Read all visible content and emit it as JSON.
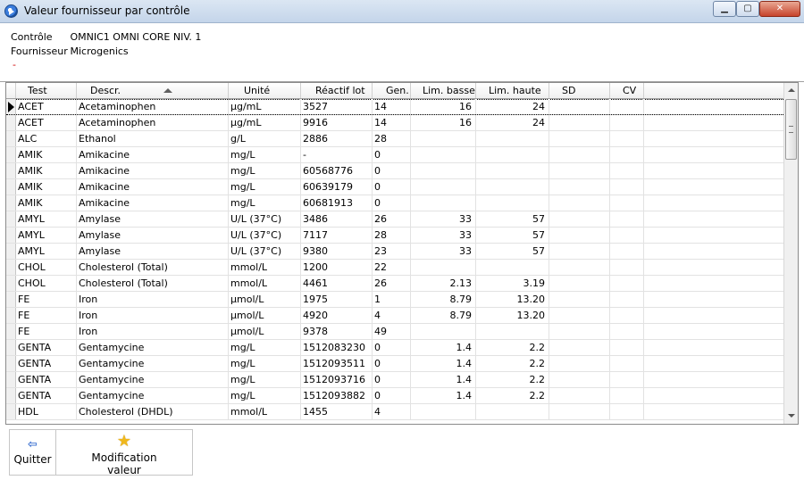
{
  "window": {
    "title": "Valeur fournisseur par contrôle",
    "minimize": "▁",
    "maximize": "▢",
    "close": "✕"
  },
  "info": {
    "control_label": "Contrôle",
    "control_value": "OMNIC1 OMNI CORE NIV. 1",
    "supplier_label": "Fournisseur",
    "supplier_value": "Microgenics",
    "dash": "-"
  },
  "grid": {
    "columns": [
      "Test",
      "Descr.",
      "Unité",
      "Réactif lot",
      "Gen.",
      "Lim. basse",
      "Lim. haute",
      "SD",
      "CV"
    ],
    "rows": [
      [
        "ACET",
        "Acetaminophen",
        "µg/mL",
        "3527",
        "14",
        "16",
        "24",
        "",
        ""
      ],
      [
        "ACET",
        "Acetaminophen",
        "µg/mL",
        "9916",
        "14",
        "16",
        "24",
        "",
        ""
      ],
      [
        "ALC",
        "Ethanol",
        "g/L",
        "2886",
        "28",
        "",
        "",
        "",
        ""
      ],
      [
        "AMIK",
        "Amikacine",
        "mg/L",
        "-",
        "0",
        "",
        "",
        "",
        ""
      ],
      [
        "AMIK",
        "Amikacine",
        "mg/L",
        "60568776",
        "0",
        "",
        "",
        "",
        ""
      ],
      [
        "AMIK",
        "Amikacine",
        "mg/L",
        "60639179",
        "0",
        "",
        "",
        "",
        ""
      ],
      [
        "AMIK",
        "Amikacine",
        "mg/L",
        "60681913",
        "0",
        "",
        "",
        "",
        ""
      ],
      [
        "AMYL",
        "Amylase",
        "U/L (37°C)",
        "3486",
        "26",
        "33",
        "57",
        "",
        ""
      ],
      [
        "AMYL",
        "Amylase",
        "U/L (37°C)",
        "7117",
        "28",
        "33",
        "57",
        "",
        ""
      ],
      [
        "AMYL",
        "Amylase",
        "U/L (37°C)",
        "9380",
        "23",
        "33",
        "57",
        "",
        ""
      ],
      [
        "CHOL",
        "Cholesterol (Total)",
        "mmol/L",
        "1200",
        "22",
        "",
        "",
        "",
        ""
      ],
      [
        "CHOL",
        "Cholesterol (Total)",
        "mmol/L",
        "4461",
        "26",
        "2.13",
        "3.19",
        "",
        ""
      ],
      [
        "FE",
        "Iron",
        "µmol/L",
        "1975",
        "1",
        "8.79",
        "13.20",
        "",
        ""
      ],
      [
        "FE",
        "Iron",
        "µmol/L",
        "4920",
        "4",
        "8.79",
        "13.20",
        "",
        ""
      ],
      [
        "FE",
        "Iron",
        "µmol/L",
        "9378",
        "49",
        "",
        "",
        "",
        ""
      ],
      [
        "GENTA",
        "Gentamycine",
        "mg/L",
        "1512083230",
        "0",
        "1.4",
        "2.2",
        "",
        ""
      ],
      [
        "GENTA",
        "Gentamycine",
        "mg/L",
        "1512093511",
        "0",
        "1.4",
        "2.2",
        "",
        ""
      ],
      [
        "GENTA",
        "Gentamycine",
        "mg/L",
        "1512093716",
        "0",
        "1.4",
        "2.2",
        "",
        ""
      ],
      [
        "GENTA",
        "Gentamycine",
        "mg/L",
        "1512093882",
        "0",
        "1.4",
        "2.2",
        "",
        ""
      ],
      [
        "HDL",
        "Cholesterol (DHDL)",
        "mmol/L",
        "1455",
        "4",
        "",
        "",
        "",
        ""
      ]
    ]
  },
  "toolbar": {
    "quit_label": "Quitter",
    "modify_label_1": "Modification",
    "modify_label_2": "valeur",
    "quit_icon": "⇦",
    "star_icon": "★"
  }
}
